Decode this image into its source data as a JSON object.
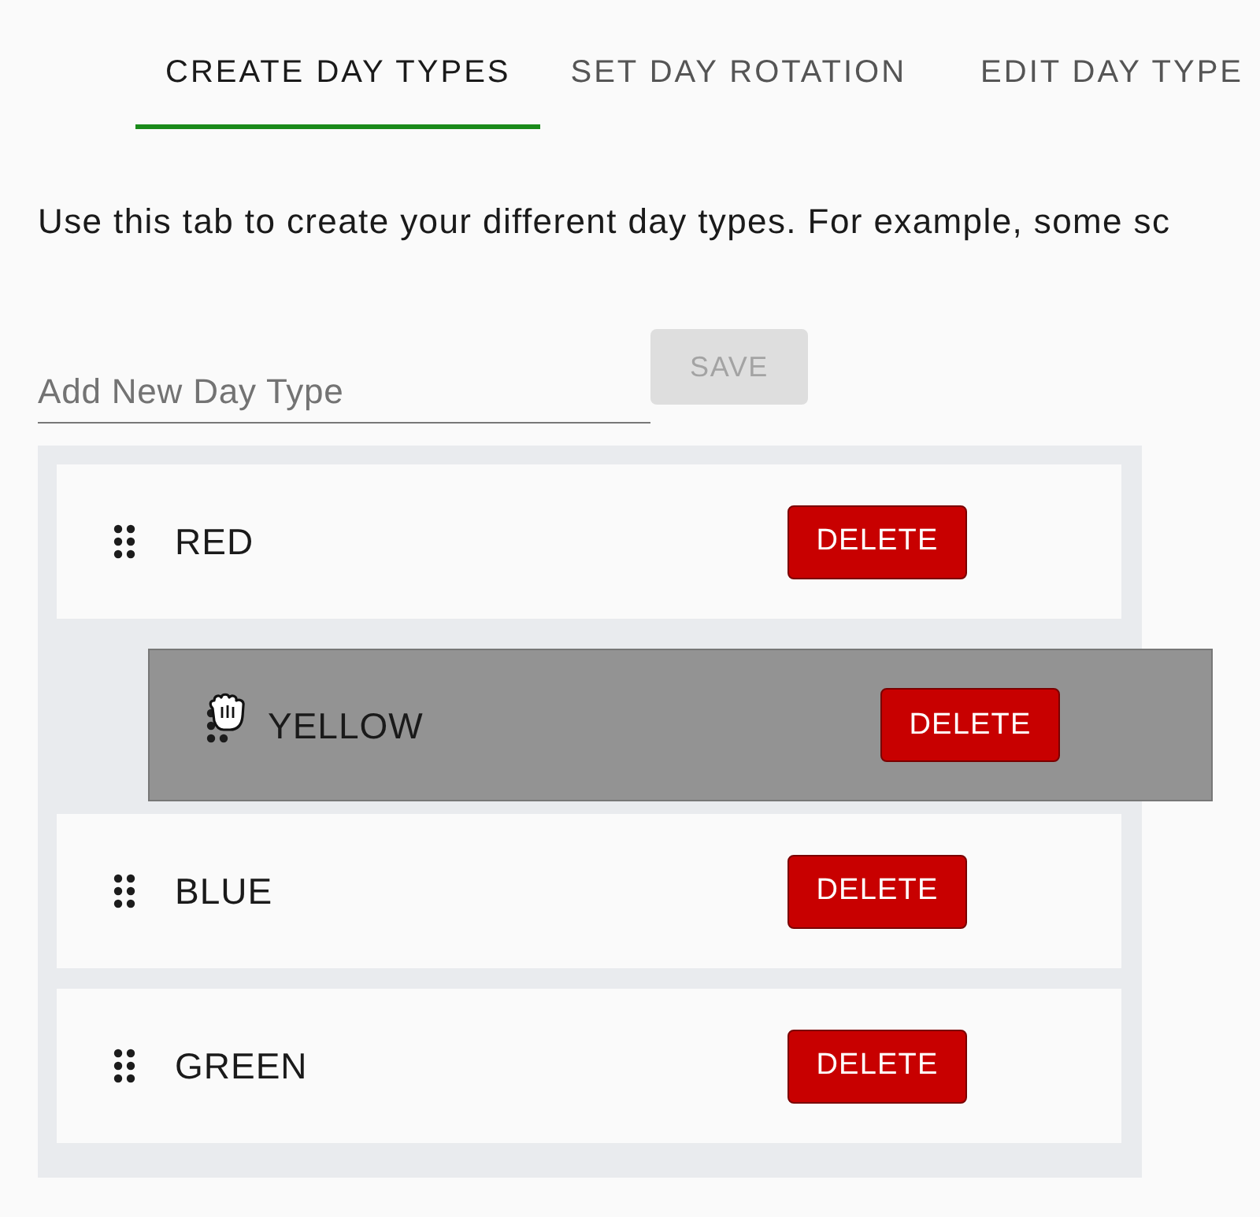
{
  "tabs": [
    {
      "label": "CREATE DAY TYPES",
      "selected": true
    },
    {
      "label": "SET DAY ROTATION",
      "selected": false
    },
    {
      "label": "EDIT DAY TYPE",
      "selected": false
    }
  ],
  "intro": "Use this tab to create your different day types. For example, some sc",
  "new_day_type": {
    "placeholder": "Add New Day Type"
  },
  "save_button": {
    "label": "SAVE",
    "disabled": true
  },
  "day_types": [
    {
      "name": "RED",
      "dragging": false,
      "delete_label": "DELETE"
    },
    {
      "name": "YELLOW",
      "dragging": true,
      "delete_label": "DELETE"
    },
    {
      "name": "BLUE",
      "dragging": false,
      "delete_label": "DELETE"
    },
    {
      "name": "GREEN",
      "dragging": false,
      "delete_label": "DELETE"
    }
  ]
}
